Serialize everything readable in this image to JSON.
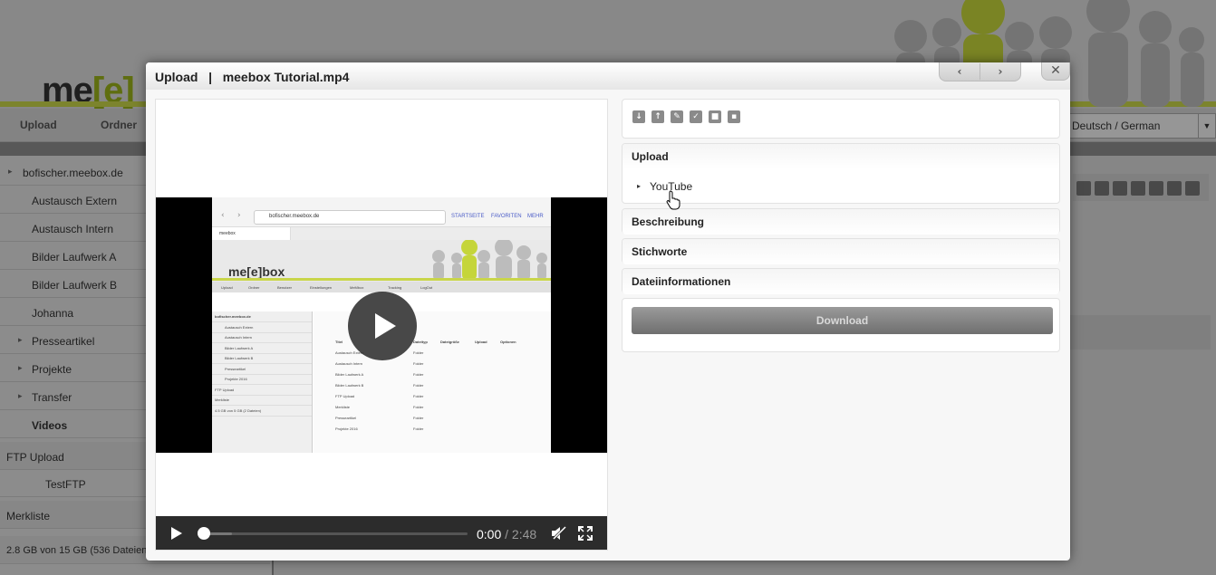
{
  "background": {
    "logo_prefix": "me",
    "logo_bracket": "[e]",
    "nav": [
      "Upload",
      "Ordner"
    ],
    "language": "Deutsch / German",
    "sidebar": [
      {
        "label": "bofischer.meebox.de",
        "caret": true,
        "indent": 0,
        "bold": false
      },
      {
        "label": "Austausch Extern",
        "caret": false,
        "indent": 1,
        "bold": false
      },
      {
        "label": "Austausch Intern",
        "caret": false,
        "indent": 1,
        "bold": false
      },
      {
        "label": "Bilder Laufwerk A",
        "caret": false,
        "indent": 1,
        "bold": false
      },
      {
        "label": "Bilder Laufwerk B",
        "caret": false,
        "indent": 1,
        "bold": false
      },
      {
        "label": "Johanna",
        "caret": false,
        "indent": 1,
        "bold": false
      },
      {
        "label": "Presseartikel",
        "caret": true,
        "indent": 1,
        "bold": false
      },
      {
        "label": "Projekte",
        "caret": true,
        "indent": 1,
        "bold": false
      },
      {
        "label": "Transfer",
        "caret": true,
        "indent": 1,
        "bold": false
      },
      {
        "label": "Videos",
        "caret": false,
        "indent": 1,
        "bold": true
      },
      {
        "label": "FTP Upload",
        "caret": false,
        "indent": 0,
        "bold": false
      },
      {
        "label": "TestFTP",
        "caret": false,
        "indent": 2,
        "bold": false
      },
      {
        "label": "Merkliste",
        "caret": false,
        "indent": 0,
        "bold": false
      },
      {
        "label": "2.8 GB von 15 GB (536 Dateien)",
        "caret": false,
        "indent": 0,
        "bold": false,
        "small": true
      }
    ]
  },
  "modal": {
    "title": "Upload   |   meebox Tutorial.mp4",
    "prev_icon": "chevron-left-icon",
    "next_icon": "chevron-right-icon",
    "close_icon": "close-icon"
  },
  "video": {
    "current_time": "0:00",
    "duration": "/ 2:48",
    "progress": 0.0,
    "buffered": 0.11,
    "thumbnail": {
      "url": "bofischer.meebox.de",
      "links": [
        "STARTSEITE",
        "FAVORITEN",
        "MEHR"
      ],
      "tab": "meebox",
      "logo": "me[e]box",
      "nav": [
        "Upload",
        "Ordner",
        "Benutzer",
        "Einstellungen",
        "MeMbox",
        "Tracking",
        "LogOut"
      ],
      "side": [
        "bofischer.meebox.de",
        "Austausch Extern",
        "Austausch Intern",
        "Bilder Laufwerk A",
        "Bilder Laufwerk B",
        "Presseartikel",
        "Projekte 2016",
        "FTP Upload",
        "Merkliste",
        "4.5 GB von 5 GB (2 Dateien)"
      ],
      "columns": [
        "Titel",
        "Dateityp",
        "Dateigröße",
        "Upload",
        "Optionen"
      ],
      "rows": [
        [
          "Austausch Extern",
          "Folder"
        ],
        [
          "Austausch Intern",
          "Folder"
        ],
        [
          "Bilder Laufwerk A",
          "Folder"
        ],
        [
          "Bilder Laufwerk B",
          "Folder"
        ],
        [
          "FTP Upload",
          "Folder"
        ],
        [
          "Merkliste",
          "Folder"
        ],
        [
          "Presseartikel",
          "Folder"
        ],
        [
          "Projekte 2016",
          "Folder"
        ]
      ]
    }
  },
  "toolbar": {
    "tools": [
      {
        "name": "download-icon",
        "glyph": "↓"
      },
      {
        "name": "upload-icon",
        "glyph": "↑"
      },
      {
        "name": "edit-icon",
        "glyph": "✎"
      },
      {
        "name": "check-icon",
        "glyph": "✓"
      },
      {
        "name": "lock-icon",
        "glyph": "■"
      },
      {
        "name": "delete-icon",
        "glyph": "▪"
      }
    ]
  },
  "sections": {
    "upload": "Upload",
    "upload_item": "YouTube",
    "beschreibung": "Beschreibung",
    "stichworte": "Stichworte",
    "dateiinformationen": "Dateiinformationen",
    "download": "Download"
  }
}
